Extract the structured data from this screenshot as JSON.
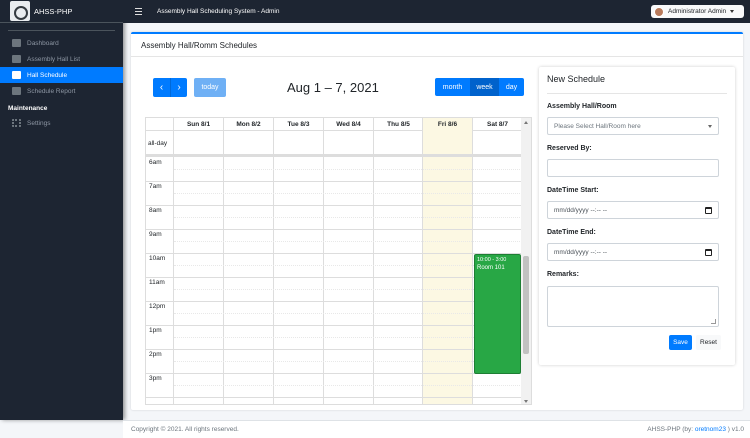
{
  "sidebar": {
    "brand": "AHSS-PHP",
    "items": [
      {
        "label": "Dashboard",
        "icon": "tachometer-icon"
      },
      {
        "label": "Assembly Hall List",
        "icon": "building-icon"
      },
      {
        "label": "Hall Schedule",
        "icon": "calendar-icon",
        "active": true
      },
      {
        "label": "Schedule Report",
        "icon": "file-icon"
      }
    ],
    "section": "Maintenance",
    "settings": {
      "label": "Settings",
      "icon": "cogs-icon"
    }
  },
  "topbar": {
    "title": "Assembly Hall Scheduling System - Admin",
    "user": "Administrator Admin"
  },
  "card": {
    "title": "Assembly Hall/Romm Schedules"
  },
  "calendar": {
    "today_label": "today",
    "title": "Aug 1 – 7, 2021",
    "views": [
      "month",
      "week",
      "day"
    ],
    "active_view": "week",
    "days": [
      "Sun 8/1",
      "Mon 8/2",
      "Tue 8/3",
      "Wed 8/4",
      "Thu 8/5",
      "Fri 8/6",
      "Sat 8/7"
    ],
    "highlight_day": "Fri 8/6",
    "allday_label": "all-day",
    "times": [
      "6am",
      "7am",
      "8am",
      "9am",
      "10am",
      "11am",
      "12pm",
      "1pm",
      "2pm",
      "3pm"
    ],
    "event": {
      "time": "10:00 - 3:00",
      "title": "Room 101",
      "day": "Sat 8/7",
      "color": "#28a745"
    }
  },
  "form": {
    "title": "New Schedule",
    "hall_label": "Assembly Hall/Room",
    "hall_placeholder": "Please Select Hall/Room here",
    "reserved_label": "Reserved By:",
    "start_label": "DateTime Start:",
    "start_value": "mm/dd/yyyy --:-- --",
    "end_label": "DateTime End:",
    "end_value": "mm/dd/yyyy --:-- --",
    "remarks_label": "Remarks:",
    "save": "Save",
    "reset": "Reset"
  },
  "footer": {
    "copyright": "Copyright © 2021. All rights reserved.",
    "right_prefix": "AHSS-PHP (by: ",
    "right_link": "oretnom23",
    "right_suffix": " ) v1.0"
  }
}
